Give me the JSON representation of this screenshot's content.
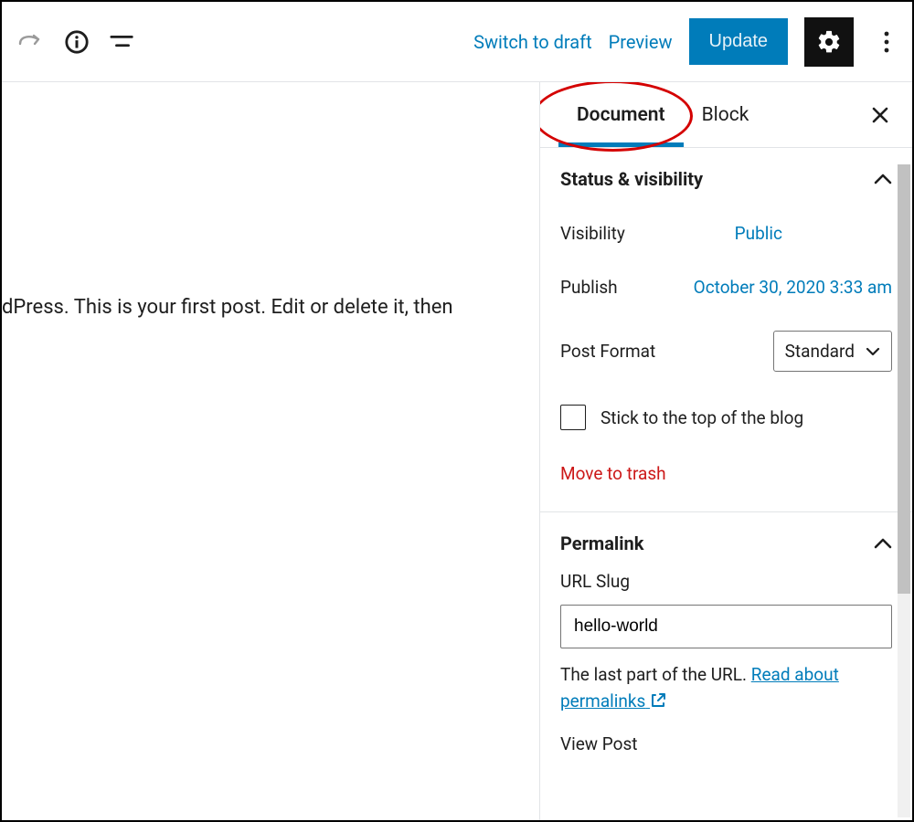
{
  "topbar": {
    "switch_draft": "Switch to draft",
    "preview": "Preview",
    "update": "Update"
  },
  "editor": {
    "content": "dPress. This is your first post. Edit or delete it, then"
  },
  "sidebar": {
    "tabs": {
      "document": "Document",
      "block": "Block"
    },
    "status": {
      "title": "Status & visibility",
      "visibility_label": "Visibility",
      "visibility_value": "Public",
      "publish_label": "Publish",
      "publish_value": "October 30, 2020 3:33 am",
      "post_format_label": "Post Format",
      "post_format_value": "Standard",
      "sticky_label": "Stick to the top of the blog",
      "trash_label": "Move to trash"
    },
    "permalink": {
      "title": "Permalink",
      "slug_label": "URL Slug",
      "slug_value": "hello-world",
      "helper_prefix": "The last part of the URL. ",
      "helper_link": "Read about permalinks",
      "view_post": "View Post"
    }
  }
}
